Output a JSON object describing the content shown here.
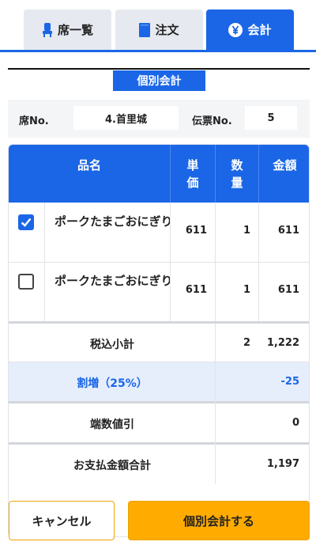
{
  "tabs": [
    {
      "label": "席一覧",
      "icon": "seat-icon"
    },
    {
      "label": "注文",
      "icon": "menu-book-icon"
    },
    {
      "label": "会計",
      "icon": "yen-icon"
    }
  ],
  "section_label": "個別会計",
  "info": {
    "seat_label": "席No.",
    "seat_value": "4.首里城",
    "slip_label": "伝票No.",
    "slip_value": "5"
  },
  "table": {
    "headers": {
      "item": "品名",
      "unit_price": "単\n価",
      "quantity": "数\n量",
      "amount": "金額"
    },
    "rows": [
      {
        "checked": true,
        "name": "ポークたまごおにぎり",
        "unit_price": "611",
        "quantity": "1",
        "amount": "611"
      },
      {
        "checked": false,
        "name": "ポークたまごおにぎり",
        "unit_price": "611",
        "quantity": "1",
        "amount": "611"
      }
    ],
    "summary": {
      "subtotal_label": "税込小計",
      "subtotal_qty": "2",
      "subtotal_amount": "1,222",
      "surcharge_label": "割増（25%）",
      "surcharge_amount": "-25",
      "rounding_label": "端数値引",
      "rounding_amount": "0",
      "total_label": "お支払金額合計",
      "total_amount": "1,197"
    }
  },
  "buttons": {
    "cancel": "キャンセル",
    "submit": "個別会計する"
  },
  "colors": {
    "primary": "#1a66e6",
    "accent": "#ffab00",
    "surcharge_bg": "#e6eefc"
  }
}
